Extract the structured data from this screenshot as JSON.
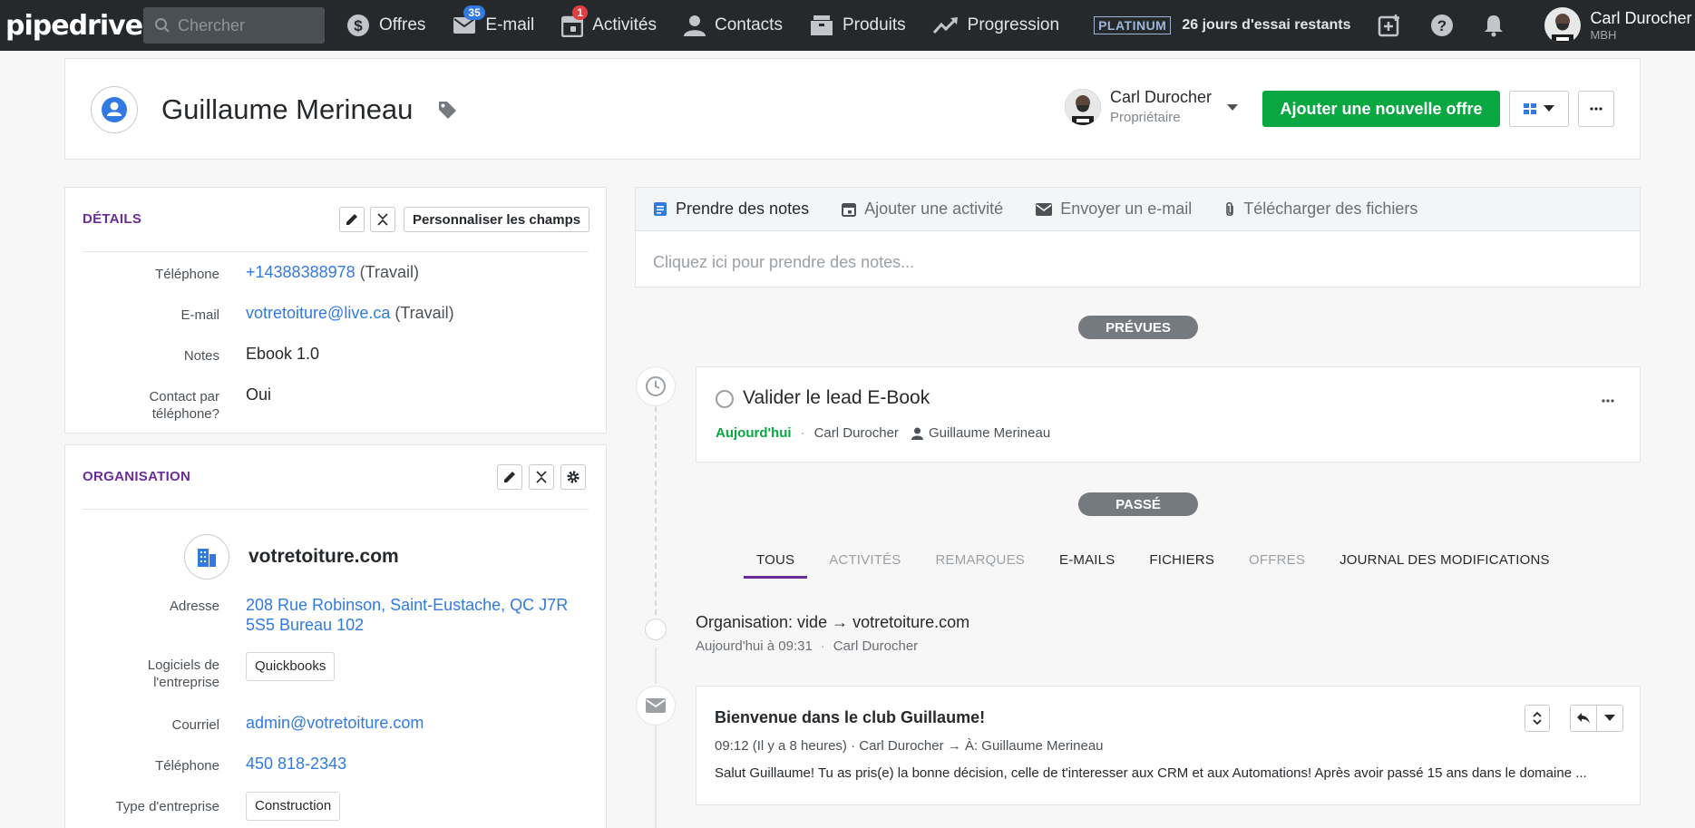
{
  "topbar": {
    "logo": "pipedrive",
    "search_placeholder": "Chercher",
    "nav": [
      {
        "label": "Offres",
        "icon": "dollar-icon"
      },
      {
        "label": "E-mail",
        "icon": "mail-icon",
        "badge": "35",
        "badge_color": "#317ae2"
      },
      {
        "label": "Activités",
        "icon": "calendar-icon",
        "badge": "1",
        "badge_color": "#e43d3d"
      },
      {
        "label": "Contacts",
        "icon": "person-icon"
      },
      {
        "label": "Produits",
        "icon": "box-icon"
      },
      {
        "label": "Progression",
        "icon": "trend-icon"
      }
    ],
    "plan": "PLATINUM",
    "trial": "26 jours d'essai restants",
    "user": {
      "name": "Carl Durocher",
      "company": "MBH"
    }
  },
  "person": {
    "name": "Guillaume Merineau",
    "owner_name": "Carl Durocher",
    "owner_role": "Propriétaire",
    "add_deal": "Ajouter une nouvelle offre"
  },
  "details": {
    "title": "DÉTAILS",
    "customize": "Personnaliser les champs",
    "fields": [
      {
        "label": "Téléphone",
        "value": "+14388388978",
        "suffix": " (Travail)"
      },
      {
        "label": "E-mail",
        "value": "votretoiture@live.ca",
        "suffix": " (Travail)"
      },
      {
        "label": "Notes",
        "value": "Ebook 1.0"
      },
      {
        "label": "Contact par téléphone?",
        "value": "Oui"
      }
    ]
  },
  "organisation": {
    "title": "ORGANISATION",
    "name": "votretoiture.com",
    "fields": [
      {
        "label": "Adresse",
        "value": "208 Rue Robinson, Saint-Eustache, QC J7R 5S5 Bureau 102"
      },
      {
        "label": "Logiciels de l'entreprise",
        "value": "Quickbooks"
      },
      {
        "label": "Courriel",
        "value": "admin@votretoiture.com"
      },
      {
        "label": "Téléphone",
        "value": "450 818-2343"
      },
      {
        "label": "Type d'entreprise",
        "value": "Construction"
      }
    ]
  },
  "notes": {
    "tabs": [
      "Prendre des notes",
      "Ajouter une activité",
      "Envoyer un e-mail",
      "Télécharger des fichiers"
    ],
    "placeholder": "Cliquez ici pour prendre des notes..."
  },
  "timeline": {
    "planned_label": "PRÉVUES",
    "past_label": "PASSÉ",
    "activity": {
      "title": "Valider le lead E-Book",
      "due": "Aujourd'hui",
      "owner": "Carl Durocher",
      "person": "Guillaume Merineau"
    },
    "history_tabs": [
      "TOUS",
      "ACTIVITÉS",
      "REMARQUES",
      "E-MAILS",
      "FICHIERS",
      "OFFRES",
      "JOURNAL DES MODIFICATIONS"
    ],
    "change": {
      "text": "Organisation: vide → votretoiture.com",
      "time": "Aujourd'hui à 09:31",
      "by": "Carl Durocher"
    },
    "email": {
      "subject": "Bienvenue dans le club Guillaume!",
      "meta": "09:12 (Il y a 8 heures) · Carl Durocher → À: Guillaume Merineau",
      "body": "Salut Guillaume! Tu as pris(e) la bonne décision, celle de t'interesser aux CRM et aux Automations! Après avoir passé 15 ans dans le domaine ..."
    }
  }
}
